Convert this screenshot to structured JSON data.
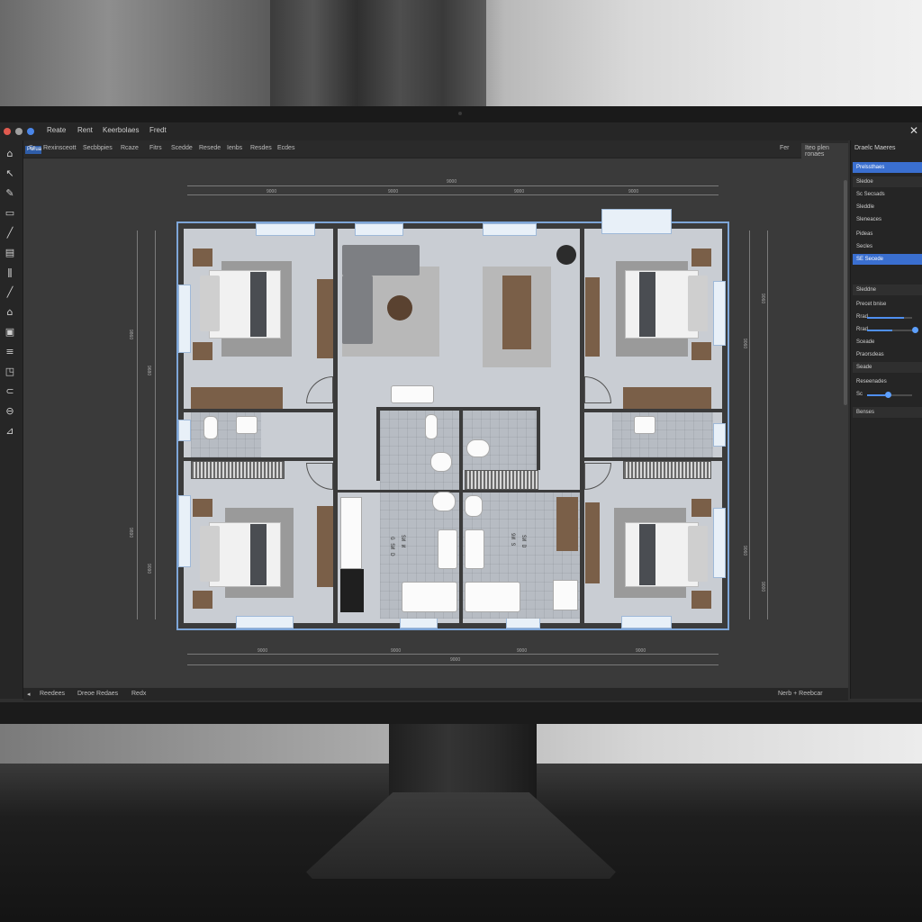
{
  "titlebar": {
    "menus": [
      "Reate",
      "Rent",
      "Keerbolaes",
      "Fredt"
    ],
    "traffic_colors": [
      "#e05a4f",
      "#a0a0a0",
      "#4a86e8"
    ]
  },
  "toolbar": {
    "items": [
      "Sr",
      "Rexinsceott",
      "Secbbpies",
      "Rcaze",
      "Fitrs",
      "Scedde",
      "Resede",
      "Ienbs",
      "Resdes",
      "Ecdes"
    ],
    "right_items": [
      "Fer",
      "Iteo plen ronaes"
    ]
  },
  "left_tools": {
    "items": [
      "home-outline-icon",
      "arrow-icon",
      "brush-icon",
      "rectangle-icon",
      "pencil-icon",
      "grid-icon",
      "ruler-icon",
      "roof-icon",
      "frame-icon",
      "text-icon",
      "node-icon",
      "magnet-icon",
      "cylinder-icon",
      "measure-icon",
      "scissors-icon"
    ],
    "active_label": "Purua"
  },
  "right_panel": {
    "header": "Draelc Maeres",
    "rows": [
      {
        "label": "Prelssthaes",
        "style": "blue"
      },
      {
        "label": "Sledoe",
        "style": "section"
      },
      {
        "label": "Sc Secsads",
        "style": "plain"
      },
      {
        "label": "Sleddle",
        "style": "plain"
      },
      {
        "label": "Sleneaces",
        "style": "plain"
      },
      {
        "label": "Pideas",
        "style": "plain"
      },
      {
        "label": "Secles",
        "style": "plain"
      },
      {
        "label": "SE Secede",
        "style": "blue"
      },
      {
        "label": "Sleddne",
        "style": "section"
      },
      {
        "label": "Precet bnise",
        "style": "plain"
      },
      {
        "label": "Rrad",
        "style": "plain"
      },
      {
        "label": "Rrad",
        "style": "plain"
      },
      {
        "label": "Sceade",
        "style": "plain"
      },
      {
        "label": "Praorsdeas",
        "style": "plain"
      },
      {
        "label": "Seade",
        "style": "section"
      },
      {
        "label": "Reseenades",
        "style": "plain"
      },
      {
        "label": "Sc",
        "style": "plain"
      },
      {
        "label": "Benses",
        "style": "section"
      }
    ],
    "slider_values": [
      0.82,
      0.55,
      0.4
    ]
  },
  "statusbar": {
    "left": [
      "Reedees",
      "Dreoe Redaes",
      "Redx"
    ],
    "right": "Nerb + Reebcar"
  },
  "plan": {
    "top_dims": [
      "9000",
      "9000",
      "9000",
      "9000",
      "9000"
    ],
    "bottom_dims": [
      "9000",
      "9000",
      "9000",
      "9000",
      "9000"
    ],
    "left_dims": [
      "9860",
      "9680",
      "9890",
      "9090"
    ],
    "right_dims": [
      "9060",
      "9060",
      "9060",
      "9000"
    ],
    "center_labels": [
      "G SИ D",
      "SИ И",
      "9И S",
      "SИ D"
    ]
  }
}
